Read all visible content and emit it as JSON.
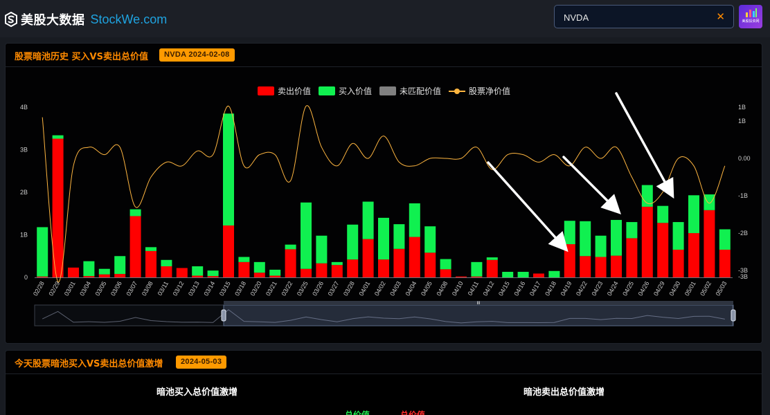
{
  "header": {
    "logo_cn": "美股大数据",
    "logo_en": "StockWe.com",
    "search_value": "NVDA",
    "clear_symbol": "✕",
    "avatar_caption": "美股投资网"
  },
  "panel1": {
    "title": "股票暗池历史 买入VS卖出总价值",
    "badge": "NVDA 2024-02-08"
  },
  "panel2": {
    "title": "今天股票暗池买入VS卖出总价值激增",
    "badge": "2024-05-03",
    "left_heading": "暗池买入总价值激增",
    "right_heading": "暗池卖出总价值激增",
    "left_sub": "总价值",
    "right_sub": "总价值"
  },
  "colors": {
    "sell": "#ff0000",
    "buy": "#10f050",
    "unmatched": "#808080",
    "net": "#ffb640",
    "accent": "#ff9a00",
    "arrow": "#ffffff"
  },
  "chart_data": {
    "type": "bar",
    "stacked": true,
    "legend": [
      "卖出价值",
      "买入价值",
      "未匹配价值",
      "股票净价值"
    ],
    "legend_position": "top-center",
    "categories": [
      "02/28",
      "02/29",
      "03/01",
      "03/04",
      "03/05",
      "03/06",
      "03/07",
      "03/08",
      "03/11",
      "03/12",
      "03/13",
      "03/14",
      "03/15",
      "03/18",
      "03/20",
      "03/21",
      "03/22",
      "03/25",
      "03/26",
      "03/27",
      "03/28",
      "04/01",
      "04/02",
      "04/03",
      "04/04",
      "04/05",
      "04/08",
      "04/10",
      "04/11",
      "04/12",
      "04/15",
      "04/16",
      "04/17",
      "04/18",
      "04/19",
      "04/22",
      "04/23",
      "04/24",
      "04/25",
      "04/26",
      "04/29",
      "04/30",
      "05/01",
      "05/02",
      "05/03"
    ],
    "series": [
      {
        "name": "卖出价值",
        "values": [
          0.02,
          3.26,
          0.23,
          0.03,
          0.07,
          0.08,
          1.44,
          0.62,
          0.26,
          0.22,
          0.04,
          0.03,
          1.22,
          0.36,
          0.11,
          0.04,
          0.66,
          0.2,
          0.33,
          0.29,
          0.42,
          0.9,
          0.42,
          0.67,
          0.95,
          0.58,
          0.19,
          0.02,
          0.02,
          0.41,
          0.0,
          0.0,
          0.09,
          0.0,
          0.78,
          0.5,
          0.48,
          0.51,
          0.92,
          1.66,
          1.28,
          0.65,
          1.04,
          1.58,
          0.65
        ]
      },
      {
        "name": "买入价值",
        "values": [
          1.16,
          0.08,
          0.0,
          0.35,
          0.13,
          0.42,
          0.16,
          0.09,
          0.15,
          0.0,
          0.22,
          0.13,
          2.63,
          0.12,
          0.25,
          0.14,
          0.11,
          1.56,
          0.65,
          0.07,
          0.82,
          0.88,
          0.98,
          0.58,
          0.79,
          0.62,
          0.24,
          0.0,
          0.34,
          0.06,
          0.13,
          0.13,
          0.0,
          0.15,
          0.55,
          0.82,
          0.5,
          0.84,
          0.38,
          0.51,
          0.4,
          0.65,
          0.89,
          0.37,
          0.48
        ]
      },
      {
        "name": "股票净价值",
        "values": [
          1.1,
          -3.3,
          -0.2,
          0.3,
          0.1,
          0.3,
          -1.3,
          -0.5,
          -0.1,
          -0.2,
          0.2,
          0.1,
          1.4,
          -0.2,
          0.1,
          0.1,
          -0.6,
          1.4,
          0.3,
          -0.2,
          0.4,
          0.0,
          0.6,
          -0.1,
          -0.2,
          0.0,
          0.0,
          0.0,
          0.3,
          -0.3,
          0.1,
          0.1,
          -0.1,
          0.1,
          -0.2,
          0.3,
          0.0,
          0.3,
          -0.5,
          -1.2,
          -0.9,
          0.0,
          -0.2,
          -1.2,
          -0.2
        ]
      }
    ],
    "y_left": {
      "ticks": [
        "4B",
        "3B",
        "2B",
        "1B",
        "0"
      ],
      "range": [
        0,
        4
      ]
    },
    "y_right": {
      "ticks": [
        "1B",
        "1B",
        "0.00",
        "-1B",
        "-2B",
        "-3B",
        "-3B"
      ]
    },
    "grid": false,
    "datazoom": {
      "handle_label": "III"
    },
    "annotations": [
      {
        "type": "arrow",
        "from": "04/12",
        "to": "04/19"
      },
      {
        "type": "arrow",
        "from": "04/22",
        "to": "04/25"
      },
      {
        "type": "arrow",
        "from": "04/26",
        "to": "04/30"
      }
    ]
  }
}
